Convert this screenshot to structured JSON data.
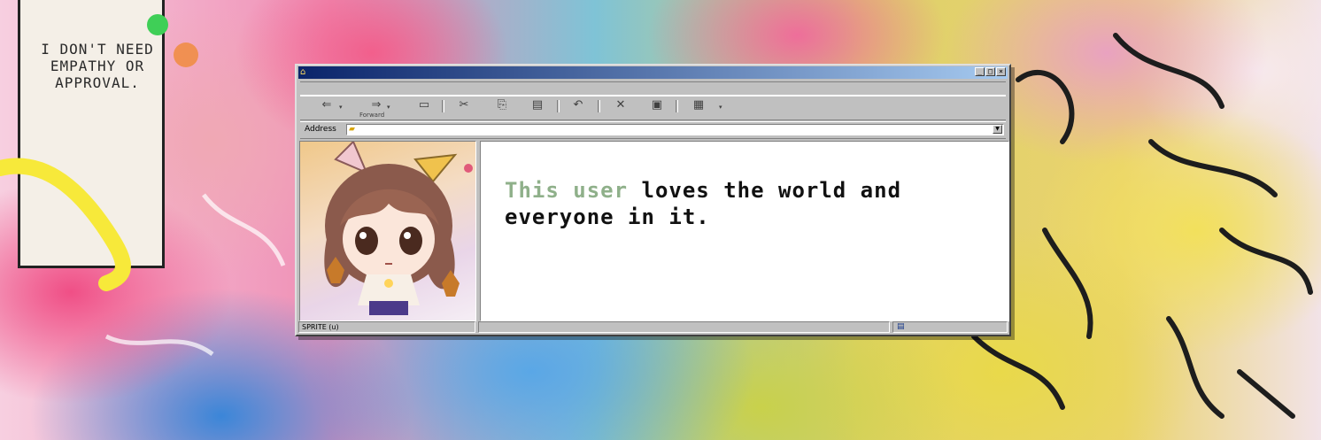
{
  "background": {
    "comic_caption": "I DON'T NEED EMPATHY OR APPROVAL."
  },
  "window": {
    "title": "",
    "title_buttons": {
      "minimize": "_",
      "maximize": "□",
      "close": "×"
    },
    "toolbar": {
      "back_icon": "back-arrow-icon",
      "forward_icon": "forward-arrow-icon",
      "forward_label": "Forward",
      "icons": [
        "up-folder-icon",
        "cut-icon",
        "copy-icon",
        "paste-icon",
        "undo-icon",
        "delete-icon",
        "properties-icon",
        "views-icon"
      ]
    },
    "address": {
      "label": "Address",
      "value": ""
    },
    "message": {
      "highlight": "This user",
      "rest": " loves the world and everyone in it."
    },
    "status": {
      "left": "SPRITE (u)",
      "middle": "",
      "right": ""
    }
  },
  "colors": {
    "highlight_text": "#8fb08a",
    "title_gradient_start": "#0a246a",
    "title_gradient_end": "#a6caf0",
    "chrome": "#c0c0c0"
  }
}
